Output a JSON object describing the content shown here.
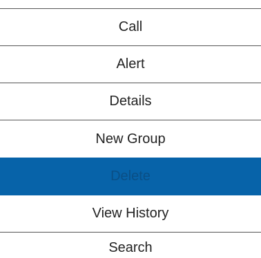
{
  "colors": {
    "selected_background": "#0763a9",
    "selected_text": "#0a4f86",
    "divider": "#555555",
    "text": "#222222",
    "background": "#ffffff"
  },
  "menu": {
    "items": [
      {
        "label": "Call"
      },
      {
        "label": "Alert"
      },
      {
        "label": "Details"
      },
      {
        "label": "New Group"
      },
      {
        "label": "Delete",
        "selected": true
      },
      {
        "label": "View History"
      },
      {
        "label": "Search"
      }
    ]
  }
}
